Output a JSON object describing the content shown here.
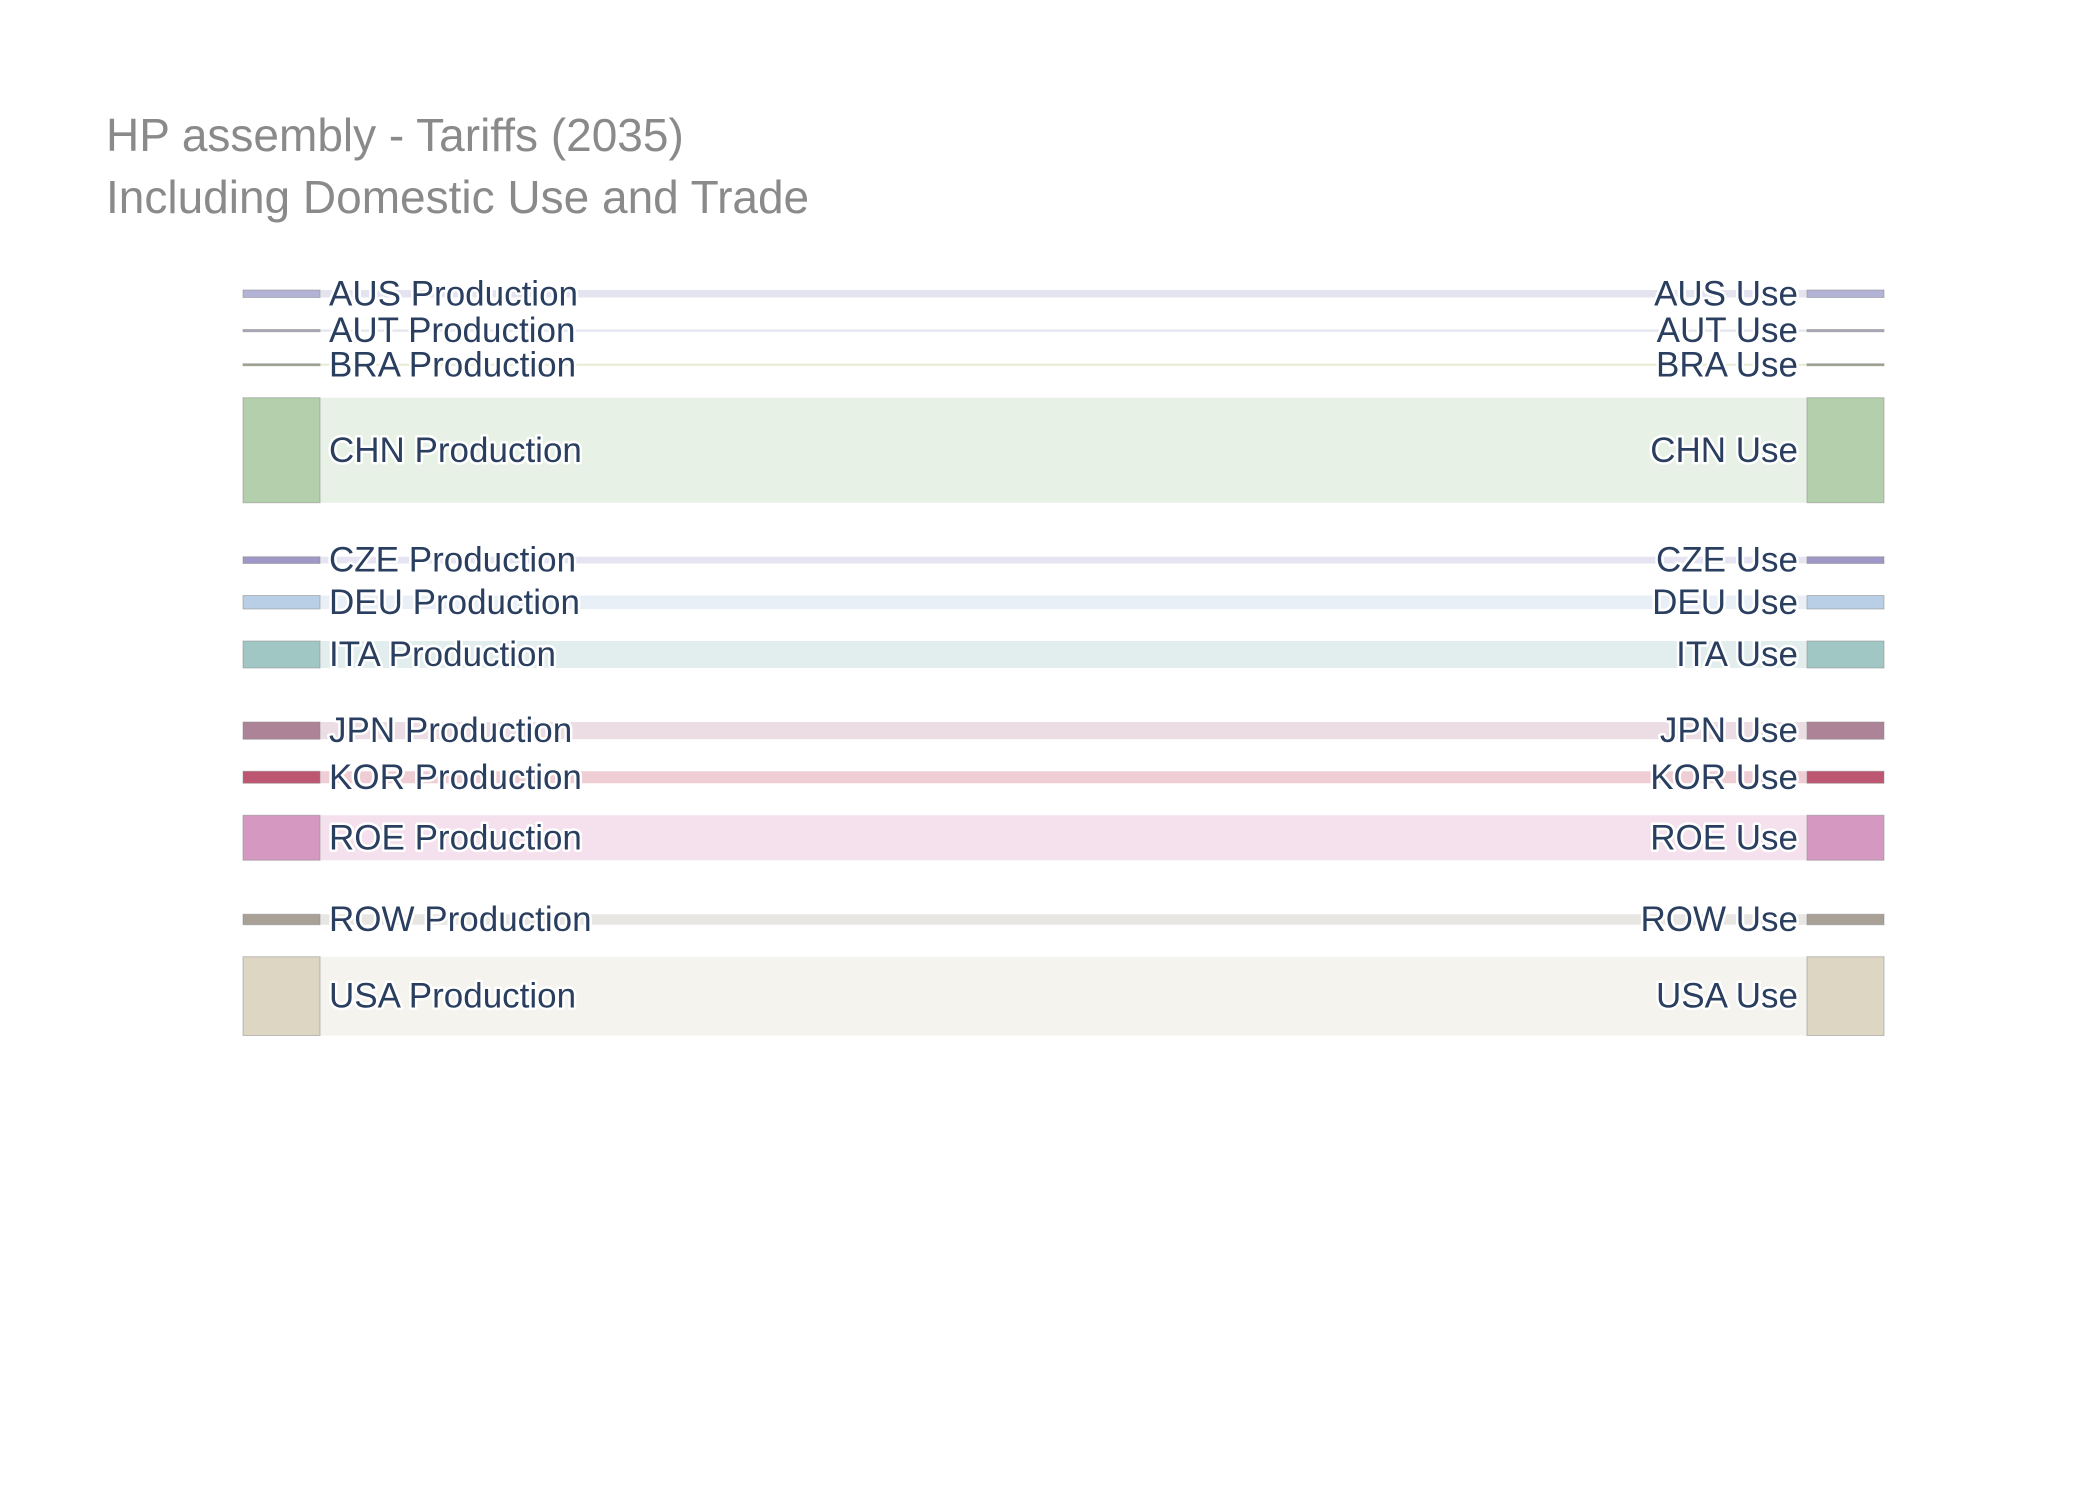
{
  "title": {
    "line1": "HP assembly - Tariffs (2035)",
    "line2": "Including Domestic Use and Trade"
  },
  "chart_data": {
    "type": "sankey",
    "flows": [
      {
        "source": "AUS Production",
        "target": "AUS Use",
        "value": 1.0,
        "node_color": "#b3b3d6",
        "link_color": "#e4e4f1"
      },
      {
        "source": "AUT Production",
        "target": "AUT Use",
        "value": 0.3,
        "node_color": "#a8a8b8",
        "link_color": "#e3e5ef"
      },
      {
        "source": "BRA Production",
        "target": "BRA Use",
        "value": 0.2,
        "node_color": "#9aa58c",
        "link_color": "#e6ecd0"
      },
      {
        "source": "CHN Production",
        "target": "CHN Use",
        "value": 14.0,
        "node_color": "#b4cfac",
        "link_color": "#e7f1e5"
      },
      {
        "source": "CZE Production",
        "target": "CZE Use",
        "value": 0.9,
        "node_color": "#9e98c6",
        "link_color": "#e6e4f3"
      },
      {
        "source": "DEU Production",
        "target": "DEU Use",
        "value": 1.8,
        "node_color": "#b9cfe6",
        "link_color": "#e8eff7"
      },
      {
        "source": "ITA Production",
        "target": "ITA Use",
        "value": 3.6,
        "node_color": "#a1c7c5",
        "link_color": "#e2eded"
      },
      {
        "source": "JPN Production",
        "target": "JPN Use",
        "value": 2.3,
        "node_color": "#ad8397",
        "link_color": "#ebdde3"
      },
      {
        "source": "KOR Production",
        "target": "KOR Use",
        "value": 1.6,
        "node_color": "#bd5771",
        "link_color": "#efcdd5"
      },
      {
        "source": "ROE Production",
        "target": "ROE Use",
        "value": 6.0,
        "node_color": "#d498c1",
        "link_color": "#f4e1ed"
      },
      {
        "source": "ROW Production",
        "target": "ROW Use",
        "value": 1.4,
        "node_color": "#aaa196",
        "link_color": "#e8e6e2"
      },
      {
        "source": "USA Production",
        "target": "USA Use",
        "value": 10.5,
        "node_color": "#ddd6c3",
        "link_color": "#f5f3ee"
      }
    ]
  }
}
